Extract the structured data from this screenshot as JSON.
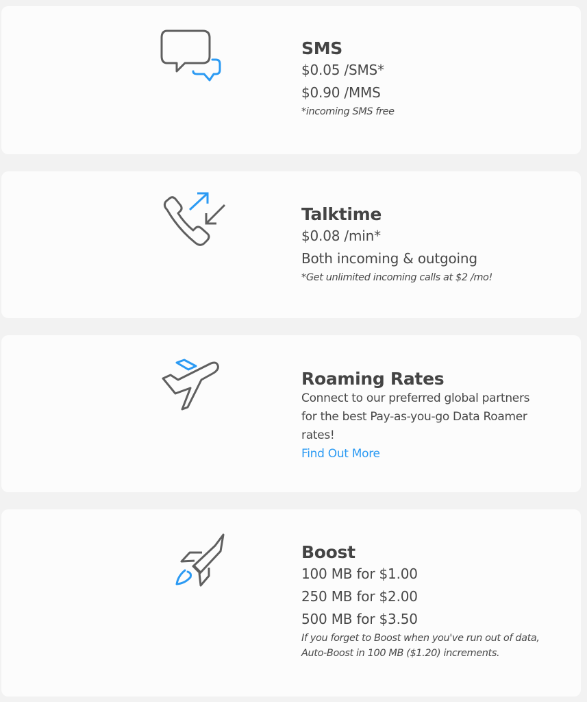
{
  "colors": {
    "accent": "#2b9af3",
    "icon_gray": "#5f5f5f",
    "text": "#444444",
    "card_bg": "#fcfcfc",
    "page_bg": "#f2f2f2"
  },
  "cards": [
    {
      "icon": "chat-bubbles-icon",
      "title": "SMS",
      "lines": [
        "$0.05 /SMS*",
        "$0.90 /MMS"
      ],
      "note": "*incoming SMS free"
    },
    {
      "icon": "phone-call-arrows-icon",
      "title": "Talktime",
      "lines": [
        "$0.08 /min*",
        "Both incoming & outgoing"
      ],
      "note": "*Get unlimited incoming calls at $2 /mo!"
    },
    {
      "icon": "airplane-takeoff-icon",
      "title": "Roaming Rates",
      "description_lines": [
        "Connect to our preferred global partners",
        "for the best Pay-as-you-go Data Roamer",
        "rates!"
      ],
      "link_label": "Find Out More"
    },
    {
      "icon": "rocket-icon",
      "title": "Boost",
      "lines": [
        "100 MB for $1.00",
        "250 MB for $2.00",
        "500 MB for $3.50"
      ],
      "note_lines": [
        "If you forget to Boost when you've run out of data,",
        "Auto-Boost in 100 MB ($1.20) increments."
      ]
    }
  ]
}
